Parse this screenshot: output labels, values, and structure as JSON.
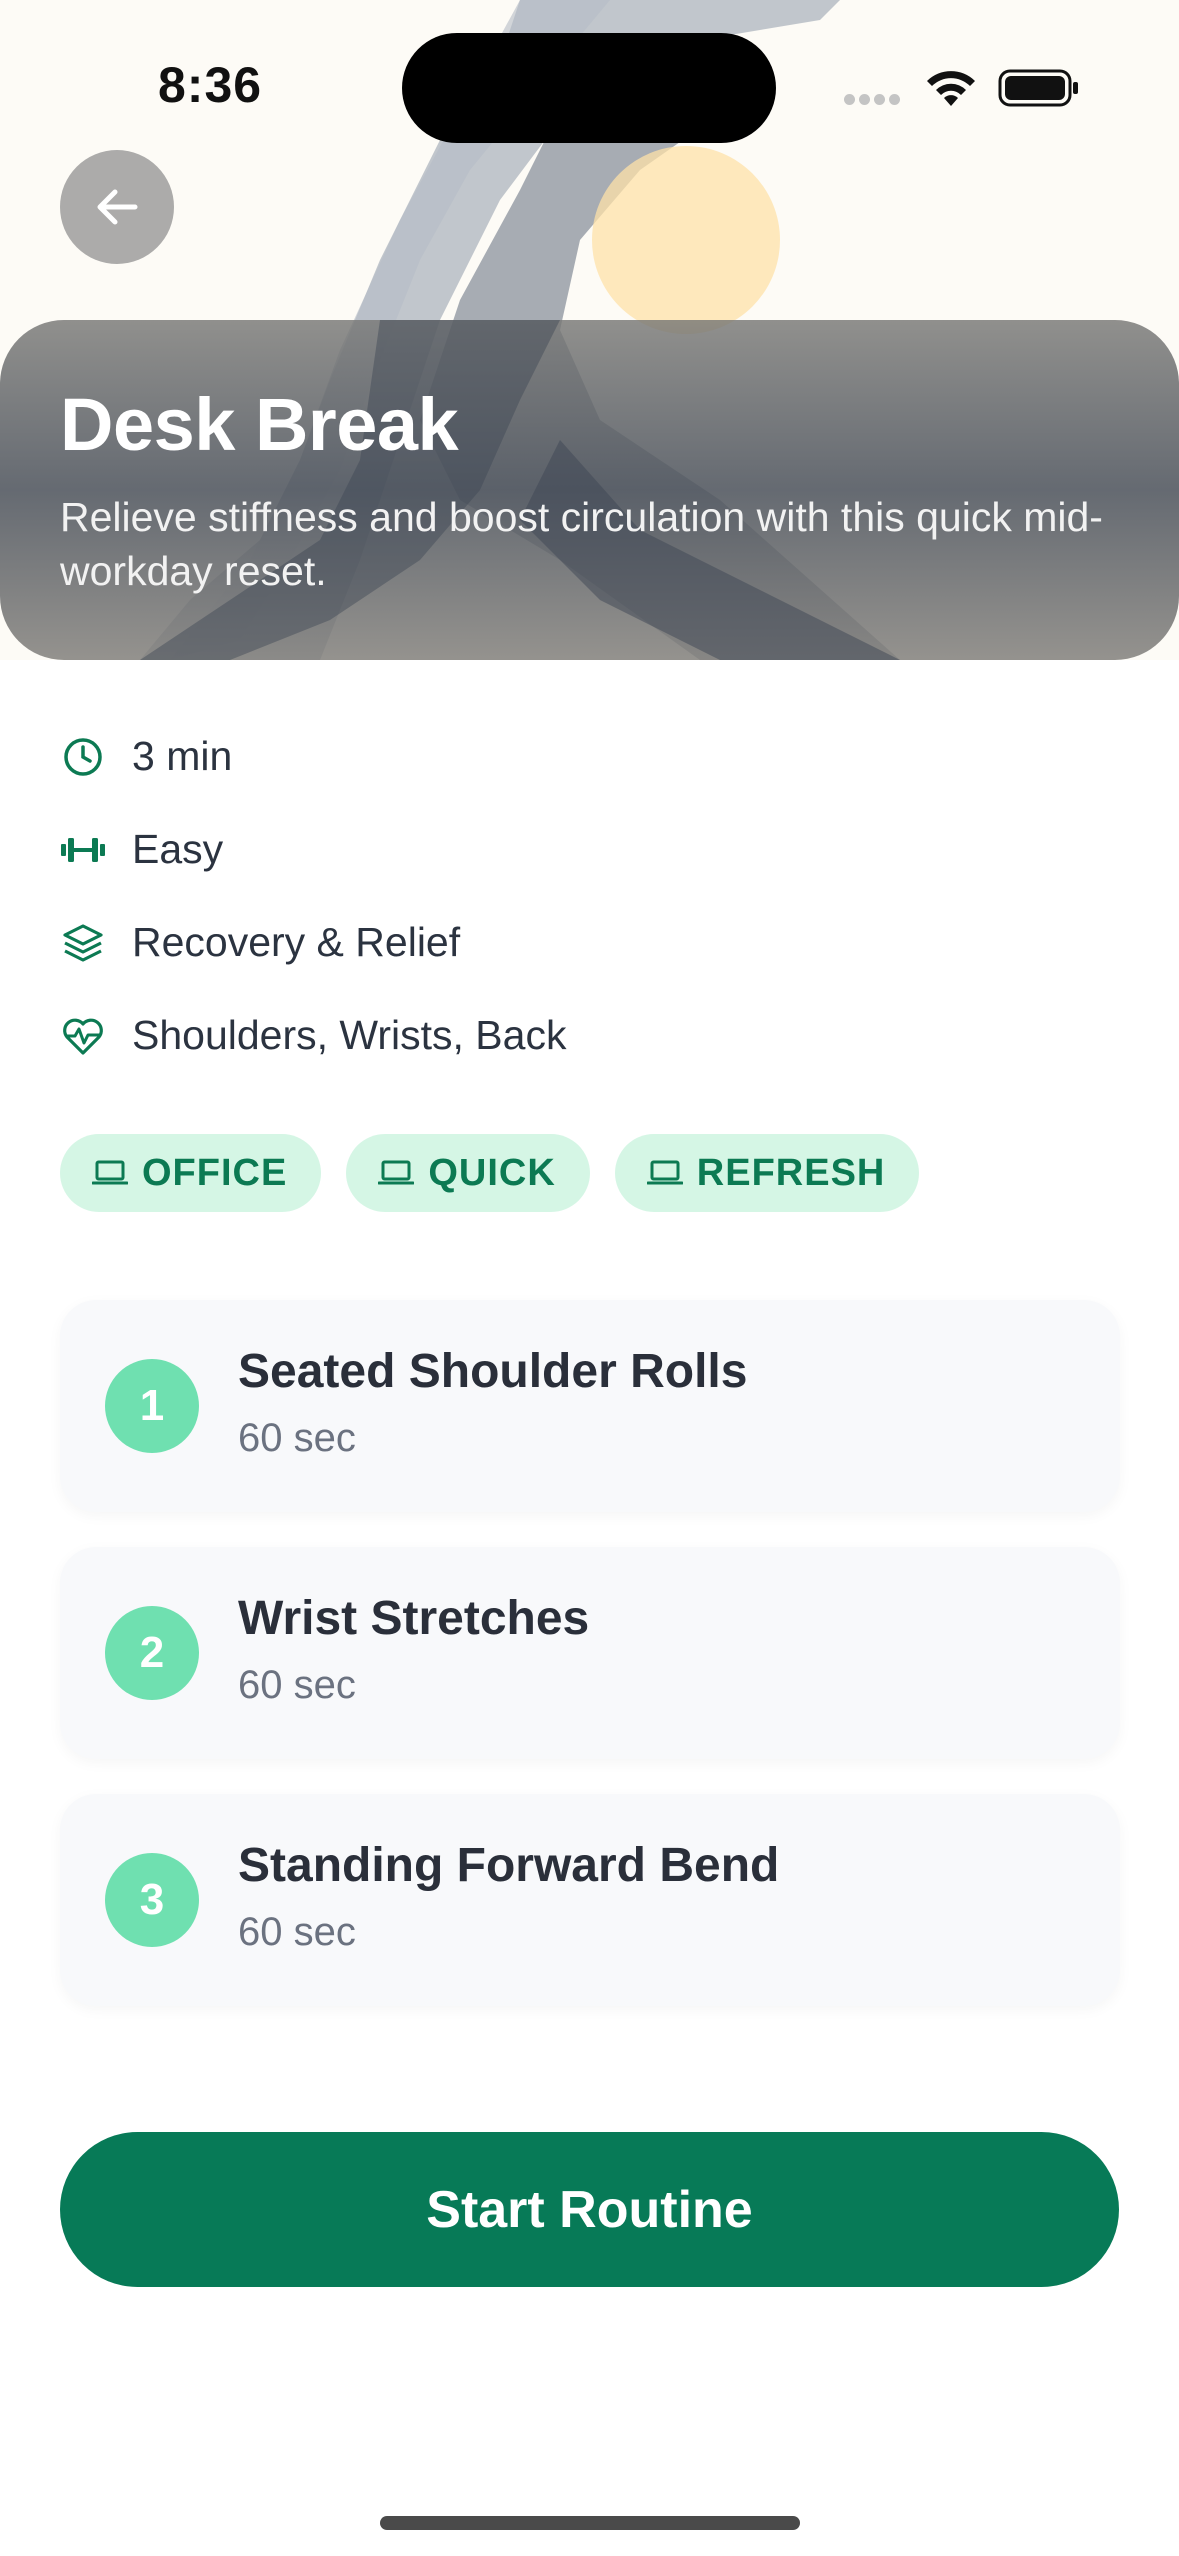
{
  "status_bar": {
    "time": "8:36"
  },
  "header": {
    "title": "Desk Break",
    "subtitle": "Relieve stiffness and boost circulation with this quick mid-workday reset."
  },
  "meta": {
    "duration": "3 min",
    "difficulty": "Easy",
    "category": "Recovery & Relief",
    "focus_areas": "Shoulders, Wrists, Back"
  },
  "tags": [
    "OFFICE",
    "QUICK",
    "REFRESH"
  ],
  "steps": [
    {
      "number": "1",
      "name": "Seated Shoulder Rolls",
      "duration": "60 sec"
    },
    {
      "number": "2",
      "name": "Wrist Stretches",
      "duration": "60 sec"
    },
    {
      "number": "3",
      "name": "Standing Forward Bend",
      "duration": "60 sec"
    }
  ],
  "actions": {
    "start_label": "Start Routine"
  },
  "colors": {
    "accent": "#077a57",
    "tag_background": "#d5f6e5",
    "tag_text": "#0c7a53",
    "step_badge": "#6fe0b0"
  },
  "icons": {
    "back": "arrow-left-icon",
    "duration": "clock-icon",
    "difficulty": "dumbbell-icon",
    "category": "layers-icon",
    "focus": "heart-pulse-icon",
    "tag": "laptop-icon"
  }
}
